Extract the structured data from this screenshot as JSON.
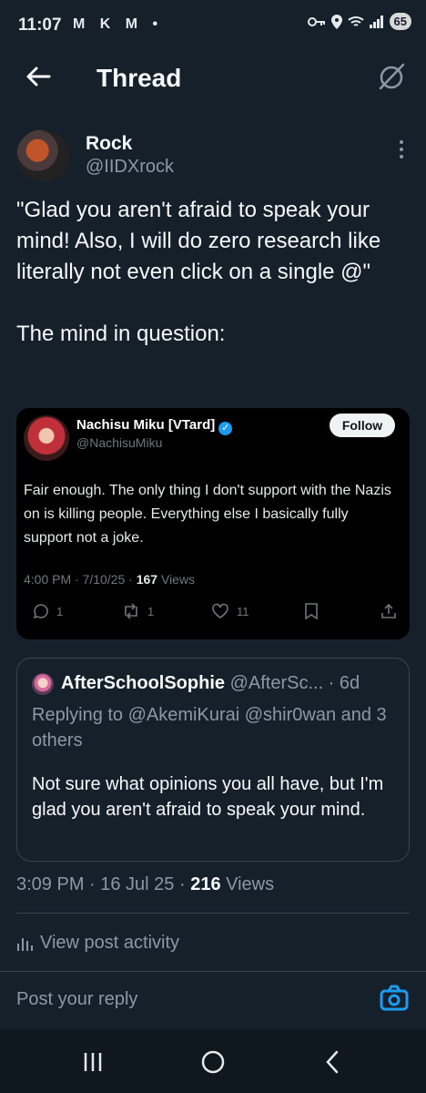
{
  "status_bar": {
    "time": "11:07",
    "left_icons": "M K M •",
    "battery": "65"
  },
  "header": {
    "title": "Thread"
  },
  "post": {
    "author_name": "Rock",
    "author_handle": "@IIDXrock",
    "text": "\"Glad you aren't afraid to speak your mind! Also, I will do zero research like literally not even click on a single @\"\n\nThe mind in question:"
  },
  "embedded_image": {
    "name": "Nachisu Miku [VTard]",
    "handle": "@NachisuMiku",
    "follow_label": "Follow",
    "text": "Fair enough. The only thing I don't support with the Nazis on is killing people. Everything else I basically fully support not a joke.",
    "meta_time": "4:00 PM · 7/10/25 · ",
    "meta_views_count": "167",
    "meta_views_label": " Views",
    "replies": "1",
    "reposts": "1",
    "likes": "11"
  },
  "quoted_post": {
    "name": "AfterSchoolSophie",
    "handle_time": " @AfterSc... · 6d",
    "replying_to": "Replying to @AkemiKurai @shir0wan and 3 others",
    "text": "Not sure what opinions you all have, but I'm glad you aren't afraid to speak your mind."
  },
  "post_meta": {
    "time": "3:09 PM · 16 Jul 25 · ",
    "views_count": "216",
    "views_label": " Views"
  },
  "activity": {
    "label": "View post activity"
  },
  "reply": {
    "placeholder": "Post your reply"
  },
  "colors": {
    "background": "#15202b",
    "accent": "#1d9bf0",
    "secondary_text": "#8b98a5"
  }
}
